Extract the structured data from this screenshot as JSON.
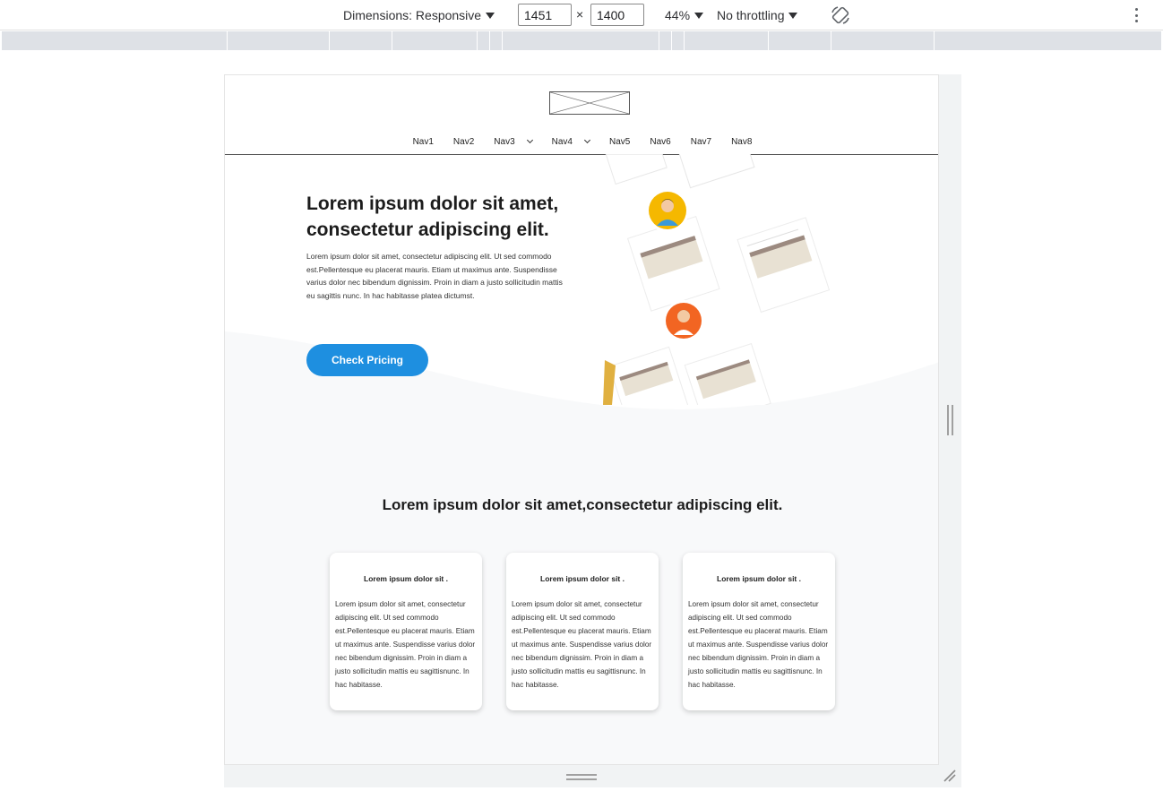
{
  "devtools": {
    "dimensions_label": "Dimensions: Responsive",
    "width_value": "1451",
    "times_sign": "×",
    "height_value": "1400",
    "zoom": "44%",
    "throttling": "No throttling",
    "icons": [
      "caret-down-icon",
      "rotate-icon",
      "more-vertical-icon"
    ]
  },
  "site": {
    "nav": [
      "Nav1",
      "Nav2",
      "Nav3",
      "Nav4",
      "Nav5",
      "Nav6",
      "Nav7",
      "Nav8"
    ],
    "hero": {
      "title": "Lorem ipsum dolor sit amet, consectetur adipiscing elit.",
      "text": "Lorem ipsum dolor sit amet, consectetur adipiscing elit. Ut sed commodo est.Pellentesque eu placerat mauris. Etiam ut maximus ante. Suspendisse varius dolor nec bibendum dignissim. Proin in diam a justo sollicitudin mattis eu sagittis nunc. In hac habitasse platea dictumst.",
      "button": "Check Pricing"
    },
    "section": {
      "title": "Lorem ipsum dolor sit amet,consectetur adipiscing elit.",
      "cards": [
        {
          "title": "Lorem ipsum dolor sit .",
          "text": "Lorem ipsum dolor sit amet, consectetur adipiscing elit. Ut sed commodo est.Pellentesque eu placerat mauris. Etiam ut maximus ante. Suspendisse varius dolor nec bibendum dignissim. Proin in diam a justo sollicitudin mattis eu sagittisnunc. In hac habitasse."
        },
        {
          "title": "Lorem ipsum dolor sit .",
          "text": "Lorem ipsum dolor sit amet, consectetur adipiscing elit. Ut sed commodo est.Pellentesque eu placerat mauris. Etiam ut maximus ante. Suspendisse varius dolor nec bibendum dignissim. Proin in diam a justo sollicitudin mattis eu sagittisnunc. In hac habitasse."
        },
        {
          "title": "Lorem ipsum dolor sit .",
          "text": "Lorem ipsum dolor sit amet, consectetur adipiscing elit. Ut sed commodo est.Pellentesque eu placerat mauris. Etiam ut maximus ante. Suspendisse varius dolor nec bibendum dignissim. Proin in diam a justo sollicitudin mattis eu sagittisnunc. In hac habitasse."
        }
      ]
    }
  },
  "colors": {
    "button": "#1e8fe0",
    "section_bg": "#f8f9fa",
    "avatar_yellow": "#f5b800",
    "avatar_orange": "#f26522"
  }
}
